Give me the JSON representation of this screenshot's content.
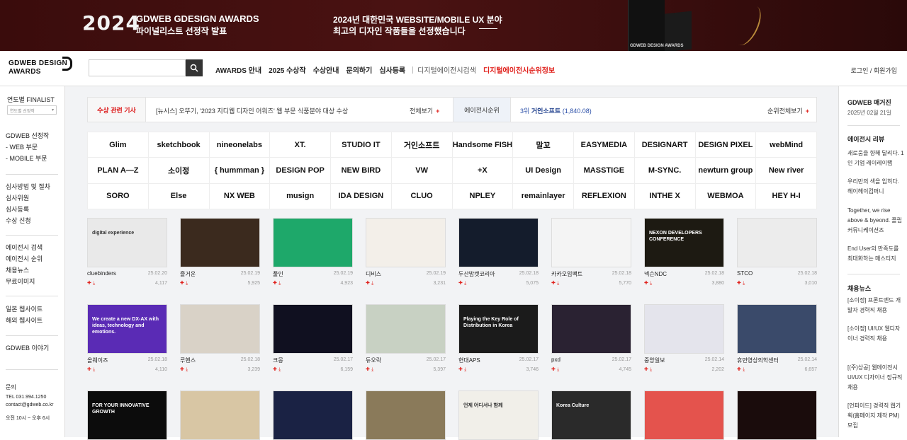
{
  "banner": {
    "big": "2024",
    "t1": "GDWEB GDESIGN AWARDS",
    "t2": "파이널리스트 선정작 발표",
    "m1": "2024년 대한민국 WEBSITE/MOBILE UX 분야",
    "m2": "최고의 디자인 작품들을 선정했습니다",
    "box": "GDWEB DESIGN AWARDS"
  },
  "header": {
    "logo_line1": "GDWEB DESIGN",
    "logo_line2": "AWARDS",
    "search_placeholder": "",
    "nav": [
      "AWARDS 안내",
      "2025 수상작",
      "수상안내",
      "문의하기",
      "심사등록",
      "디지털에이전시검색",
      "디지털에이전시순위정보"
    ],
    "login": "로그인",
    "join": "회원가입"
  },
  "left": {
    "title": "연도별 FINALIST",
    "select": "연도별 선정작",
    "g1": [
      "GDWEB 선정작",
      "- WEB 부문",
      "- MOBILE 부문"
    ],
    "g2": [
      "심사방법 및 절차",
      "심사위원",
      "심사등록",
      "수상 신청"
    ],
    "g3": [
      "에이전시 검색",
      "에이전시 순위",
      "채용뉴스",
      "무료이미지"
    ],
    "g4": [
      "일본 웹사이트",
      "해외 웹사이트"
    ],
    "g5": [
      "GDWEB 이야기"
    ],
    "contact_title": "문의",
    "tel": "TEL 031.994.1250",
    "email": "contact@gdweb.co.kr",
    "hours": "오전 10시 ~ 오후 6시"
  },
  "news": {
    "label": "수상 관련 기사",
    "text": "[뉴시스] 오뚜기, '2023 지디웹 디자인 어워즈' 웹 부문 식품분야 대상 수상",
    "more": "전체보기",
    "label2": "에이전시순위",
    "rank_no": "3위",
    "rank_name": "거인소프트",
    "rank_score": "(1,840.08)",
    "more2": "순위전체보기"
  },
  "logos": [
    "Glim",
    "sketchbook",
    "nineonelabs",
    "XT.",
    "STUDIO IT",
    "거인소프트",
    "Handsome FISH",
    "말꼬",
    "EASYMEDIA",
    "DESIGNART",
    "DESIGN PIXEL",
    "webMind",
    "PLAN A—Z",
    "소이정",
    "{ hummman }",
    "DESIGN POP",
    "NEW BIRD",
    "VW",
    "+X",
    "UI Design",
    "MASSTIGE",
    "M-SYNC.",
    "newturn group",
    "New river",
    "SORO",
    "Else",
    "NX WEB",
    "musign",
    "IDA DESIGN",
    "CLUO",
    "NPLEY",
    "remainlayer",
    "REFLEXION",
    "INTHE X",
    "WEBMOA",
    "HEY H-I"
  ],
  "cards": [
    {
      "name": "cluebinders",
      "date": "25.02.20",
      "views": "4,117"
    },
    {
      "name": "즐거운",
      "date": "25.02.19",
      "views": "5,925"
    },
    {
      "name": "풀인",
      "date": "25.02.19",
      "views": "4,923"
    },
    {
      "name": "디비스",
      "date": "25.02.19",
      "views": "3,231"
    },
    {
      "name": "두산밥캣코리아",
      "date": "25.02.18",
      "views": "5,075"
    },
    {
      "name": "카카오임팩트",
      "date": "25.02.18",
      "views": "5,770"
    },
    {
      "name": "넥슨NDC",
      "date": "25.02.18",
      "views": "3,880"
    },
    {
      "name": "STCO",
      "date": "25.02.18",
      "views": "3,010"
    },
    {
      "name": "올웨이즈",
      "date": "25.02.18",
      "views": "4,110"
    },
    {
      "name": "루헨스",
      "date": "25.02.18",
      "views": "3,239"
    },
    {
      "name": "크몽",
      "date": "25.02.17",
      "views": "6,159"
    },
    {
      "name": "듀오락",
      "date": "25.02.17",
      "views": "5,397"
    },
    {
      "name": "현대APS",
      "date": "25.02.17",
      "views": "3,746"
    },
    {
      "name": "pxd",
      "date": "25.02.17",
      "views": "4,745"
    },
    {
      "name": "중앙일보",
      "date": "25.02.14",
      "views": "2,202"
    },
    {
      "name": "휴먼영상의학센터",
      "date": "25.02.14",
      "views": "6,657"
    },
    {
      "name": "",
      "date": "",
      "views": ""
    },
    {
      "name": "",
      "date": "",
      "views": ""
    },
    {
      "name": "",
      "date": "",
      "views": ""
    },
    {
      "name": "",
      "date": "",
      "views": ""
    },
    {
      "name": "",
      "date": "",
      "views": ""
    },
    {
      "name": "",
      "date": "",
      "views": ""
    },
    {
      "name": "",
      "date": "",
      "views": ""
    },
    {
      "name": "",
      "date": "",
      "views": ""
    }
  ],
  "card_colors": [
    "#e9e9e9",
    "#3b2a1e",
    "#1ea86a",
    "#f3efe9",
    "#141c2c",
    "#f4f4f4",
    "#1d1a12",
    "#ececec",
    "#5a2bb5",
    "#d9d2c7",
    "#101020",
    "#c8d1c3",
    "#1b1b1b",
    "#2a2232",
    "#e4e4ec",
    "#3a4a6a",
    "#0c0c0c",
    "#d8c6a4",
    "#1a2244",
    "#8a7a5a",
    "#f1efe9",
    "#2a2a2a",
    "#e4534d",
    "#1a0c0c"
  ],
  "card_texts": [
    "digital experience",
    "",
    "",
    "",
    "",
    "",
    "NEXON DEVELOPERS CONFERENCE",
    "",
    "We create a new DX-AX with ideas, technology and emotions.",
    "",
    "",
    "",
    "Playing the Key Role of Distribution in Korea",
    "",
    "",
    "",
    "FOR YOUR INNOVATIVE GROWTH",
    "",
    "",
    "",
    "언제 어디서나 함께",
    "Korea Culture",
    "",
    ""
  ],
  "right": {
    "mag_title": "GDWEB 매거진",
    "mag_date": "2025년 02월 21일",
    "review_title": "에이전시 리뷰",
    "reviews": [
      "새로움을 향해 달리다. 1인 기업 레이레이랩",
      "우리만의 색을 입히다. 헤이헤이컴퍼니",
      "Together, we rise above & byeond. 플립커뮤니케이션즈",
      "End User의 만족도를 최대화하는 매스티지"
    ],
    "jobs_title": "채용뉴스",
    "jobs": [
      "[소이정] 프론트엔드 개발자 경력직 채용",
      "[소이정] UI/UX 웹디자이너 경력직 채용",
      "[(주)상공] 웹에이전시 UI/UX 디자이너 정규직 채용",
      "[언피이드] 경력직 웹기획(홈페이지 제작 PM) 모집"
    ]
  }
}
